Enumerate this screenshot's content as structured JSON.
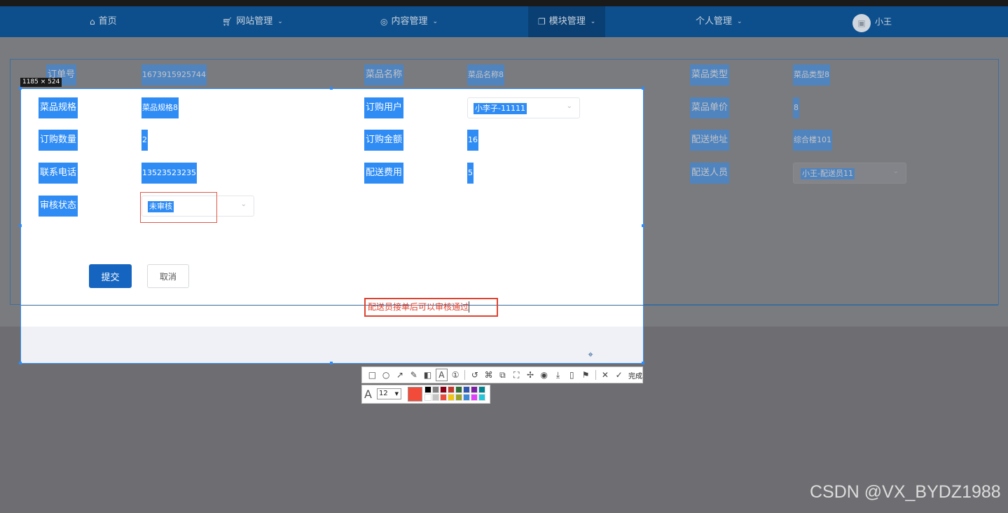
{
  "nav": {
    "home": "首页",
    "site": "网站管理",
    "content": "内容管理",
    "module": "模块管理",
    "personal": "个人管理",
    "user": "小王"
  },
  "background_form": {
    "order_no_label": "订单号",
    "order_no": "1673915925744",
    "dish_name_label": "菜品名称",
    "dish_name": "菜品名称8",
    "dish_type_label": "菜品类型",
    "dish_type": "菜品类型8",
    "unit_price_label": "菜品单价",
    "unit_price": "8",
    "address_label": "配送地址",
    "address": "综合楼101",
    "courier_label": "配送人员",
    "courier": "小王-配送员11"
  },
  "capture": {
    "size_badge": "1185 × 524",
    "spec_label": "菜品规格",
    "spec": "菜品规格8",
    "buyer_label": "订购用户",
    "buyer": "小李子-11111",
    "qty_label": "订购数量",
    "qty": "2",
    "amount_label": "订购金额",
    "amount": "16",
    "phone_label": "联系电话",
    "phone": "13523523235",
    "fee_label": "配送费用",
    "fee": "5",
    "status_label": "审核状态",
    "status": "未审核",
    "submit": "提交",
    "cancel": "取消",
    "annotation": "配送员接单后可以审核通过"
  },
  "toolbar": {
    "done": "完成",
    "font_size": "12",
    "current_color": "#f24b3a",
    "palette_top": [
      "#000000",
      "#7f7f7f",
      "#880015",
      "#c0392b",
      "#2f6e3a",
      "#3056b0",
      "#7b1fa2",
      "#00838f"
    ],
    "palette_bottom": [
      "#ffffff",
      "#c3c3c3",
      "#e74c3c",
      "#f1c40f",
      "#9aa52a",
      "#3d8bd8",
      "#e040fb",
      "#26c6da"
    ]
  },
  "watermark": "CSDN @VX_BYDZ1988"
}
